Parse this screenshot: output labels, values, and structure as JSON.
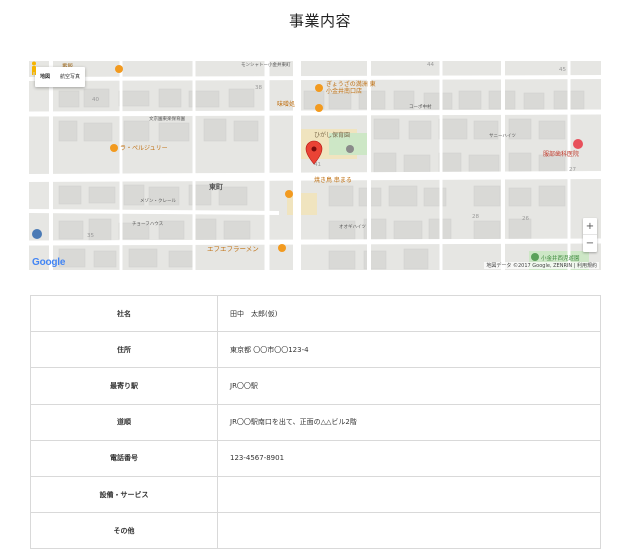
{
  "page": {
    "title": "事業内容"
  },
  "map": {
    "type_buttons": {
      "map": "地図",
      "satellite": "航空写真"
    },
    "zoom_in": "+",
    "zoom_out": "−",
    "logo": "Google",
    "attribution": "地図データ ©2017 Google, ZENRIN | 利用規約",
    "labels": {
      "restaurant_top": "ぎょうざの満洲 東",
      "restaurant_top2": "小金井南口店",
      "ramen": "味噌処",
      "school": "ひがし保育園",
      "gyoza": "焼き鳥 串まる",
      "clinic": "服部歯科医院",
      "clinic_line2": "27",
      "cafe": "ラ・ペルジュリー",
      "ramen2": "エフエフラーメン",
      "town": "東町",
      "building1": "メゾン・クレール",
      "building2": "チョーフハウス",
      "building3": "オオギハイツ",
      "building4": "コーポ中村",
      "building5": "サニーハイツ",
      "building6": "文京園東楽保育園",
      "park": "小金井西児遊園",
      "num1": "40",
      "num2": "38",
      "num3": "45",
      "num4": "28",
      "num5": "26",
      "num6": "35",
      "num7": "44",
      "num8": "41",
      "shop1": "モンシャトー小金井東町",
      "shop2": "番飯"
    }
  },
  "table": {
    "rows": [
      {
        "label": "社名",
        "value": "田中　太郎(仮)"
      },
      {
        "label": "住所",
        "value": "東京都 〇〇市〇〇123-4"
      },
      {
        "label": "最寄り駅",
        "value": "JR〇〇駅"
      },
      {
        "label": "道順",
        "value": "JR〇〇駅南口を出て、正面の△△ビル2階"
      },
      {
        "label": "電話番号",
        "value": "123-4567-8901"
      },
      {
        "label": "設備・サービス",
        "value": ""
      },
      {
        "label": "その他",
        "value": ""
      }
    ]
  },
  "colors": {
    "map_bg": "#e8e8e6",
    "road": "#ffffff",
    "building": "#d8d8d6",
    "park": "#c8e6c0",
    "orange_poi": "#f29a1f",
    "red_pin": "#ea4335",
    "school_area": "#f0e2b8"
  }
}
